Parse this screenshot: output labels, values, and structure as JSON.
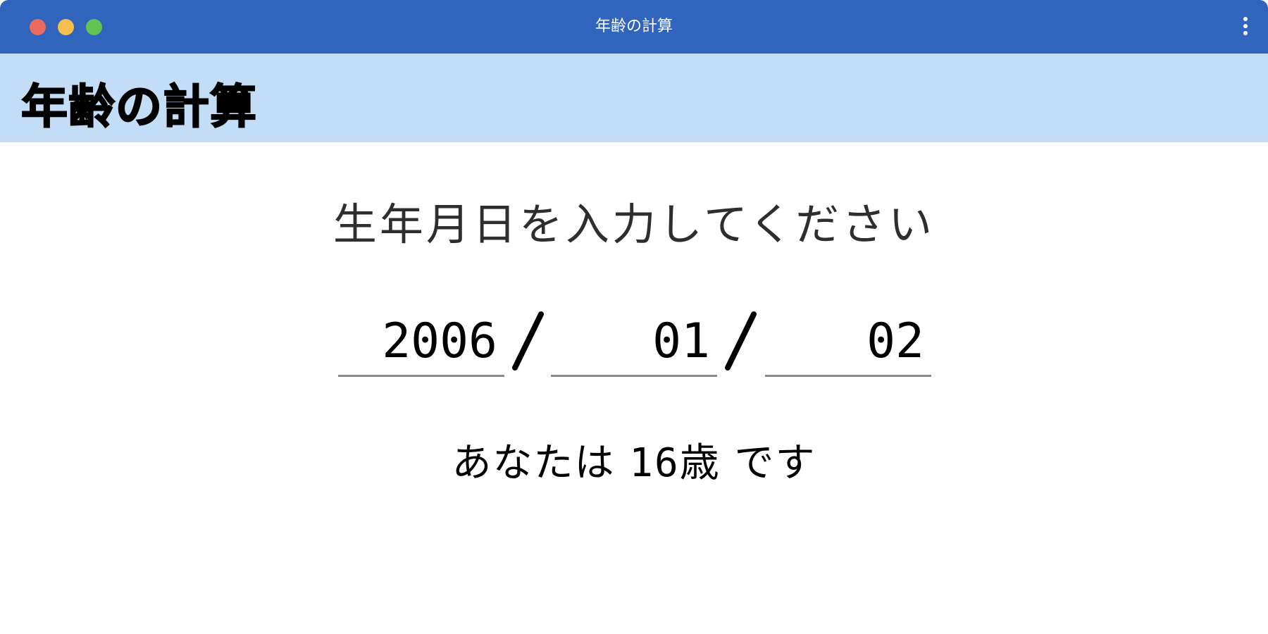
{
  "window": {
    "title": "年齢の計算"
  },
  "header": {
    "title": "年齢の計算"
  },
  "form": {
    "prompt": "生年月日を入力してください",
    "year_value": "2006",
    "month_value": "01",
    "day_value": "02",
    "separator": "/"
  },
  "result": {
    "prefix": "あなたは",
    "age": "16歳",
    "suffix": "です"
  },
  "colors": {
    "titlebar": "#3165bd",
    "header_band": "#c3ddf6",
    "close": "#ec6a5e",
    "minimize": "#f4bf4f",
    "zoom": "#61c554"
  },
  "icons": {
    "menu": "kebab-menu-icon"
  }
}
